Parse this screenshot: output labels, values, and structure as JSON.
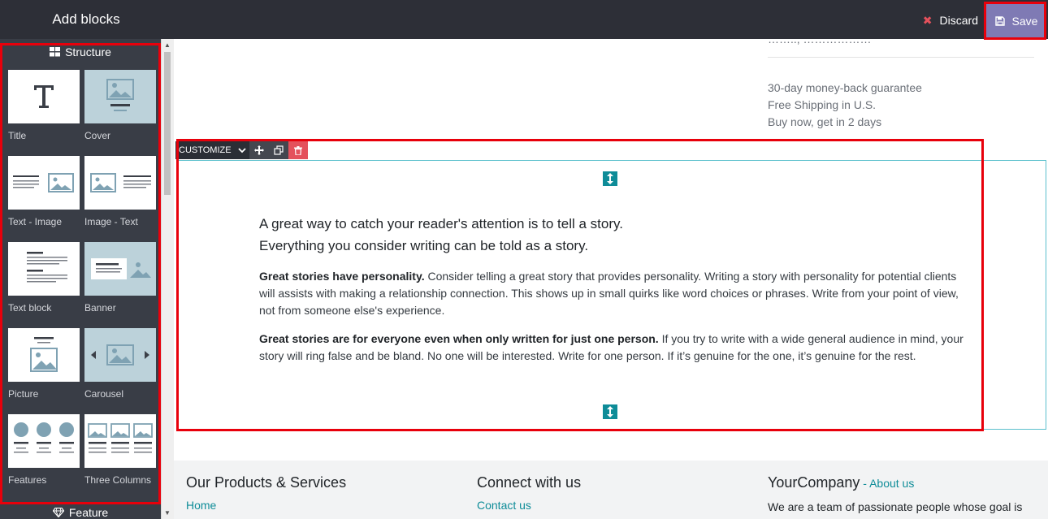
{
  "topbar": {
    "title": "Add blocks",
    "discard_label": "Discard",
    "save_label": "Save"
  },
  "sidebar": {
    "structure_heading": "Structure",
    "feature_heading": "Feature",
    "blocks": [
      {
        "label": "Title"
      },
      {
        "label": "Cover"
      },
      {
        "label": "Text - Image"
      },
      {
        "label": "Image - Text"
      },
      {
        "label": "Text block"
      },
      {
        "label": "Banner"
      },
      {
        "label": "Picture"
      },
      {
        "label": "Carousel"
      },
      {
        "label": "Features"
      },
      {
        "label": "Three Columns"
      }
    ]
  },
  "page": {
    "top_partial": "…….., ………………",
    "info_lines": [
      "30-day money-back guarantee",
      "Free Shipping in U.S.",
      "Buy now, get in 2 days"
    ],
    "toolbar": {
      "customize_label": "CUSTOMIZE"
    },
    "story": {
      "lead_line1": "A great way to catch your reader's attention is to tell a story.",
      "lead_line2": "Everything you consider writing can be told as a story.",
      "p1_bold": "Great stories have personality.",
      "p1_text": " Consider telling a great story that provides personality. Writing a story with personality for potential clients will assists with making a relationship connection. This shows up in small quirks like word choices or phrases. Write from your point of view, not from someone else's experience.",
      "p2_bold": "Great stories are for everyone even when only written for just one person.",
      "p2_text": " If you try to write with a wide general audience in mind, your story will ring false and be bland. No one will be interested. Write for one person. If it’s genuine for the one, it’s genuine for the rest."
    },
    "footer": {
      "col1_heading": "Our Products & Services",
      "col1_link": "Home",
      "col2_heading": "Connect with us",
      "col2_link": "Contact us",
      "col3_heading": "YourCompany",
      "col3_about_sep": " - ",
      "col3_about": "About us",
      "col3_text": "We are a team of passionate people whose goal is"
    }
  }
}
